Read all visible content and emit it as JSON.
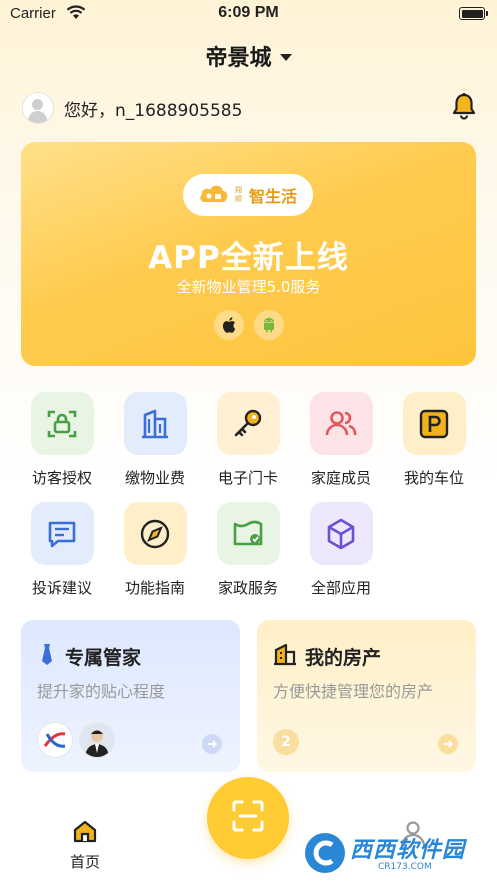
{
  "status_bar": {
    "carrier": "Carrier",
    "time": "6:09 PM"
  },
  "header": {
    "community": "帝景城"
  },
  "user": {
    "greeting": "您好，n_1688905585"
  },
  "banner": {
    "logo_small": "翔顺",
    "logo_text": "智生活",
    "title": "APP全新上线",
    "subtitle": "全新物业管理5.0服务"
  },
  "services": [
    {
      "label": "访客授权",
      "icon": "visitor-auth-icon",
      "bg": "#E8F5E4",
      "color": "#4A9E45"
    },
    {
      "label": "缴物业费",
      "icon": "property-fee-icon",
      "bg": "#E3ECFB",
      "color": "#3B6FD8"
    },
    {
      "label": "电子门卡",
      "icon": "key-icon",
      "bg": "#FFF0D3",
      "color": "#E4A516"
    },
    {
      "label": "家庭成员",
      "icon": "family-members-icon",
      "bg": "#FCE4E6",
      "color": "#E0575E"
    },
    {
      "label": "我的车位",
      "icon": "parking-icon",
      "bg": "#FFEFC9",
      "color": "#D69508"
    },
    {
      "label": "投诉建议",
      "icon": "complaint-icon",
      "bg": "#E3ECFB",
      "color": "#3B6FD8"
    },
    {
      "label": "功能指南",
      "icon": "compass-icon",
      "bg": "#FFEFC9",
      "color": "#D69508"
    },
    {
      "label": "家政服务",
      "icon": "housekeeping-icon",
      "bg": "#E8F5E4",
      "color": "#4A9E45"
    },
    {
      "label": "全部应用",
      "icon": "all-apps-icon",
      "bg": "#ECE7FA",
      "color": "#6F4FD0"
    }
  ],
  "cards": {
    "steward": {
      "title": "专属管家",
      "desc": "提升家的贴心程度"
    },
    "property": {
      "title": "我的房产",
      "desc": "方便快捷管理您的房产",
      "count": "2"
    }
  },
  "tabbar": {
    "home_label": "首页"
  },
  "watermark": {
    "text": "西西软件园",
    "sub": "CR173.COM"
  },
  "colors": {
    "accent": "#FFCB33",
    "banner": "#FFC43D"
  }
}
